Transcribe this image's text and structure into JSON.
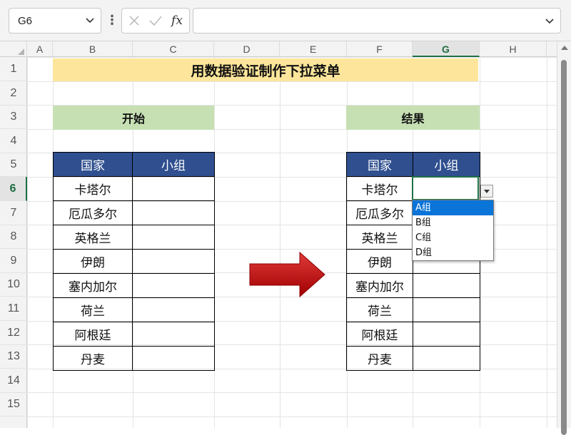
{
  "formula_bar": {
    "name_box": "G6",
    "more": "⋮",
    "fx": "fx",
    "formula": ""
  },
  "columns": [
    "A",
    "B",
    "C",
    "D",
    "E",
    "F",
    "G",
    "H"
  ],
  "rows": [
    "1",
    "2",
    "3",
    "4",
    "5",
    "6",
    "7",
    "8",
    "9",
    "10",
    "11",
    "12",
    "13",
    "14",
    "15"
  ],
  "selection": {
    "column": "G",
    "row": "6"
  },
  "sheet": {
    "title": "用数据验证制作下拉菜单",
    "start_label": "开始",
    "result_label": "结果",
    "headers": {
      "country": "国家",
      "group": "小组"
    },
    "countries": [
      "卡塔尔",
      "厄瓜多尔",
      "英格兰",
      "伊朗",
      "塞内加尔",
      "荷兰",
      "阿根廷",
      "丹麦"
    ]
  },
  "dropdown": {
    "options": [
      "A组",
      "B组",
      "C组",
      "D组"
    ],
    "highlighted_index": 0
  },
  "colors": {
    "title_fill": "#fde69b",
    "band_fill": "#c6e0b4",
    "header_fill": "#2f4f8f",
    "arrow": "#c00000",
    "selection": "#1e7145",
    "highlight": "#0a74d8"
  }
}
